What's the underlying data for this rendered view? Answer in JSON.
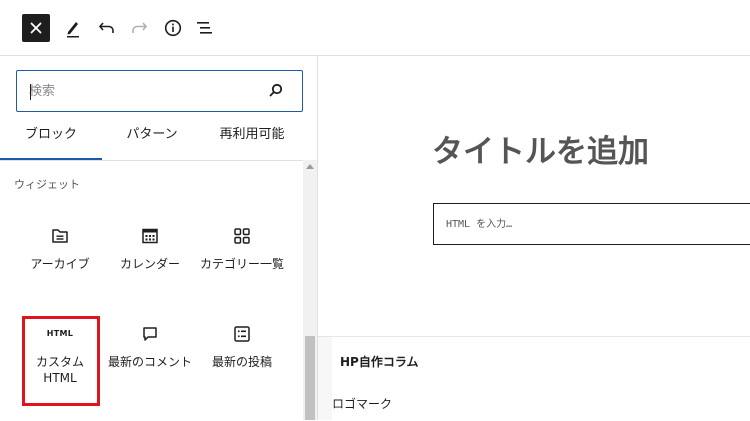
{
  "toolbar": {
    "close": "close-icon",
    "tools": "pen-icon",
    "undo": "undo-icon",
    "redo": "redo-icon",
    "details": "info-icon",
    "outline": "list-view-icon"
  },
  "inserter": {
    "search": {
      "placeholder": "検索"
    },
    "tabs": [
      {
        "label": "ブロック"
      },
      {
        "label": "パターン"
      },
      {
        "label": "再利用可能"
      }
    ],
    "section_title": "ウィジェット",
    "blocks": [
      {
        "label": "アーカイブ",
        "icon": "folder-icon"
      },
      {
        "label": "カレンダー",
        "icon": "calendar-icon"
      },
      {
        "label": "カテゴリー一覧",
        "icon": "category-icon"
      },
      {
        "label": "カスタム HTML",
        "icon_text": "HTML"
      },
      {
        "label": "最新のコメント",
        "icon": "comment-icon"
      },
      {
        "label": "最新の投稿",
        "icon": "post-list-icon"
      }
    ]
  },
  "editor": {
    "title_placeholder": "タイトルを追加",
    "html_placeholder": "HTML を入力…",
    "site_title": "HP自作コラム",
    "logo_label": "ロゴマーク"
  },
  "colors": {
    "highlight": "#e0141e",
    "accent": "#1e5aa8"
  }
}
